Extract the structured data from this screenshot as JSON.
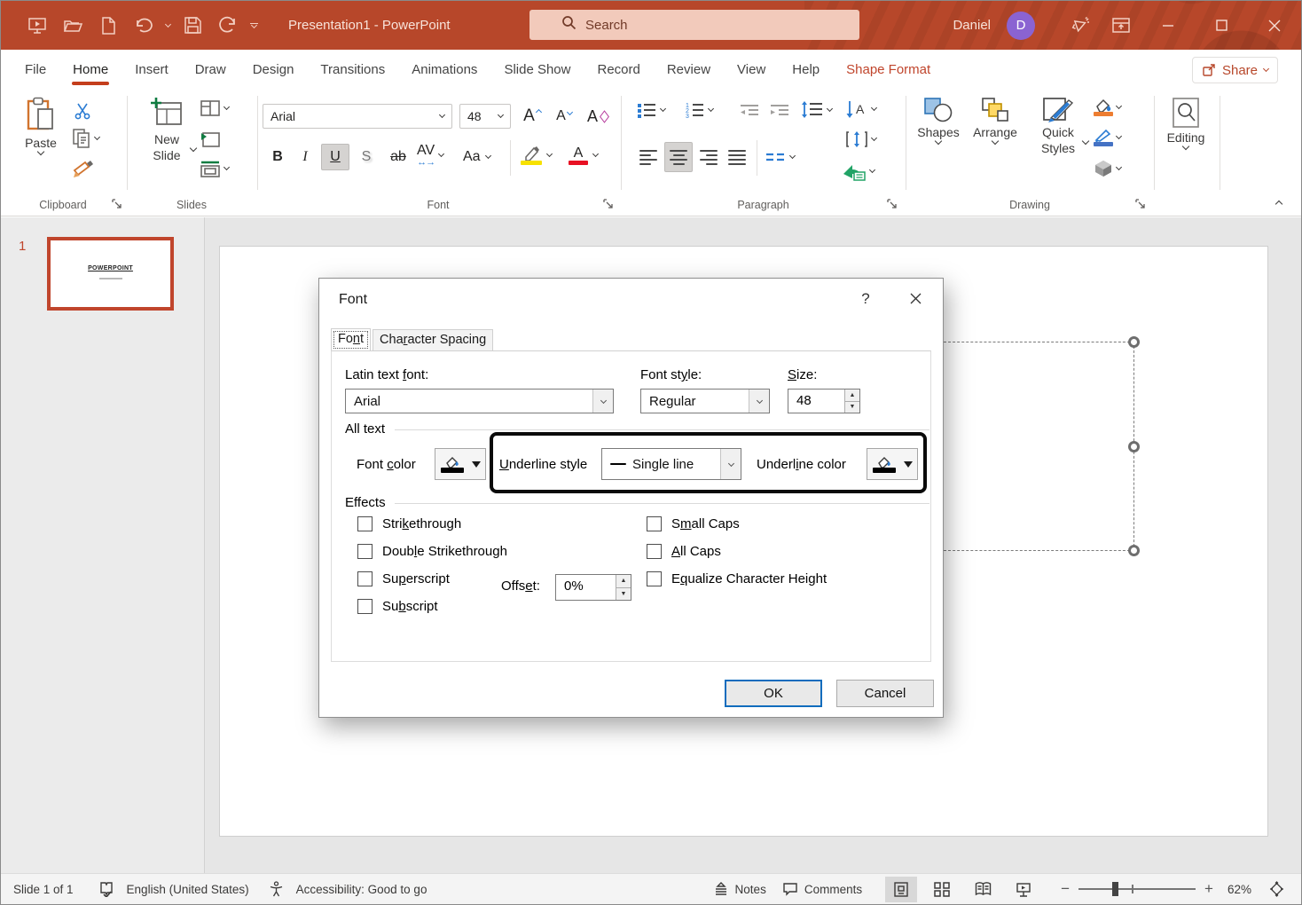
{
  "window": {
    "title": "Presentation1  -  PowerPoint",
    "user_name": "Daniel",
    "user_initial": "D",
    "search_label": "Search"
  },
  "tabs": {
    "items": [
      "File",
      "Home",
      "Insert",
      "Draw",
      "Design",
      "Transitions",
      "Animations",
      "Slide Show",
      "Record",
      "Review",
      "View",
      "Help",
      "Shape Format"
    ],
    "share": "Share"
  },
  "ribbon": {
    "clipboard": {
      "label": "Clipboard",
      "paste": "Paste"
    },
    "slides": {
      "label": "Slides",
      "new_slide": "New Slide"
    },
    "font_group": {
      "label": "Font",
      "font_name": "Arial",
      "font_size": "48",
      "bold": "B",
      "italic": "I",
      "underline": "U",
      "shadow": "S",
      "strikethrough": "ab",
      "spacing": "AV",
      "case": "Aa",
      "grow": "A",
      "shrink": "A",
      "clear": "A",
      "color": "A"
    },
    "paragraph": {
      "label": "Paragraph"
    },
    "drawing": {
      "label": "Drawing",
      "shapes": "Shapes",
      "arrange": "Arrange",
      "quick_styles": "Quick Styles"
    },
    "editing": {
      "label": "Editing"
    }
  },
  "thumbnails": {
    "number": "1",
    "slide_title": "POWERPOINT"
  },
  "dialog": {
    "title": "Font",
    "help": "?",
    "tabs": {
      "font": {
        "pre": "Fo",
        "accel": "n",
        "post": "t"
      },
      "spacing": {
        "pre": "Cha",
        "accel": "r",
        "post": "acter Spacing"
      }
    },
    "labels": {
      "latin": {
        "pre": "Latin text ",
        "accel": "f",
        "post": "ont:"
      },
      "style": {
        "pre": "Font st",
        "accel": "y",
        "post": "le:"
      },
      "size": {
        "pre": "",
        "accel": "S",
        "post": "ize:"
      },
      "all_text": "All text",
      "font_color": {
        "pre": "Font ",
        "accel": "c",
        "post": "olor"
      },
      "underline_style": {
        "pre": "",
        "accel": "U",
        "post": "nderline style"
      },
      "underline_color": {
        "pre": "Underl",
        "accel": "i",
        "post": "ne color"
      },
      "effects": "Effects",
      "strikethrough": {
        "pre": "Stri",
        "accel": "k",
        "post": "ethrough"
      },
      "double_strikethrough": {
        "pre": "Doub",
        "accel": "l",
        "post": "e Strikethrough"
      },
      "superscript": {
        "pre": "Su",
        "accel": "p",
        "post": "erscript"
      },
      "offset": {
        "pre": "Offs",
        "accel": "e",
        "post": "t:"
      },
      "subscript": {
        "pre": "Su",
        "accel": "b",
        "post": "script"
      },
      "small_caps": {
        "pre": "S",
        "accel": "m",
        "post": "all Caps"
      },
      "all_caps": {
        "pre": "",
        "accel": "A",
        "post": "ll Caps"
      },
      "equalize": {
        "pre": "E",
        "accel": "q",
        "post": "ualize Character Height"
      }
    },
    "values": {
      "latin_font": "Arial",
      "font_style": "Regular",
      "size": "48",
      "underline_style": "Single line",
      "offset": "0%"
    },
    "buttons": {
      "ok": "OK",
      "cancel": "Cancel"
    }
  },
  "statusbar": {
    "slide": "Slide 1 of 1",
    "language": "English (United States)",
    "accessibility": "Accessibility: Good to go",
    "notes": "Notes",
    "comments": "Comments",
    "zoom": "62%"
  },
  "colors": {
    "brand": "#b7472a",
    "tab_underline": "#c43e1c",
    "highlight_border": "#0a0a0a",
    "ok_border": "#0f6cbd",
    "avatar": "#8a63d2"
  }
}
